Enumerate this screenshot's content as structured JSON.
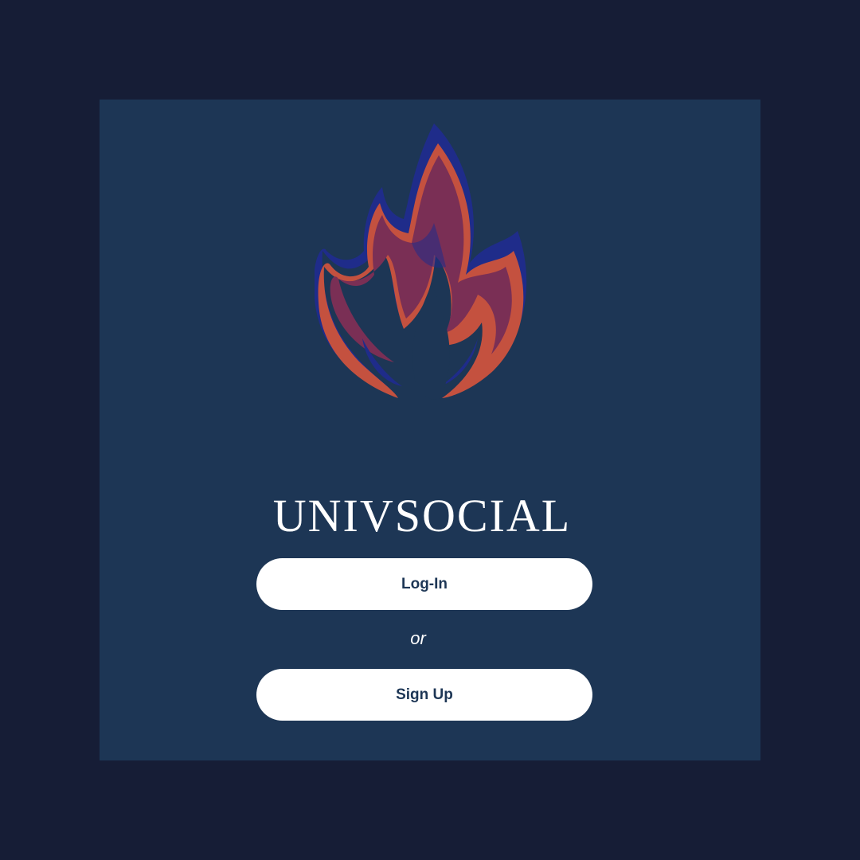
{
  "app": {
    "title": "UNIVSOCIAL",
    "logo_icon": "flame-icon"
  },
  "auth": {
    "login_label": "Log-In",
    "separator": "or",
    "signup_label": "Sign Up"
  },
  "colors": {
    "page_background": "#161d36",
    "panel_background": "#1d3655",
    "flame_outer": "#c4513f",
    "flame_inner": "#7a2f55",
    "flame_shadow": "#1f2c8a",
    "button_background": "#ffffff",
    "button_text": "#1d3655"
  }
}
